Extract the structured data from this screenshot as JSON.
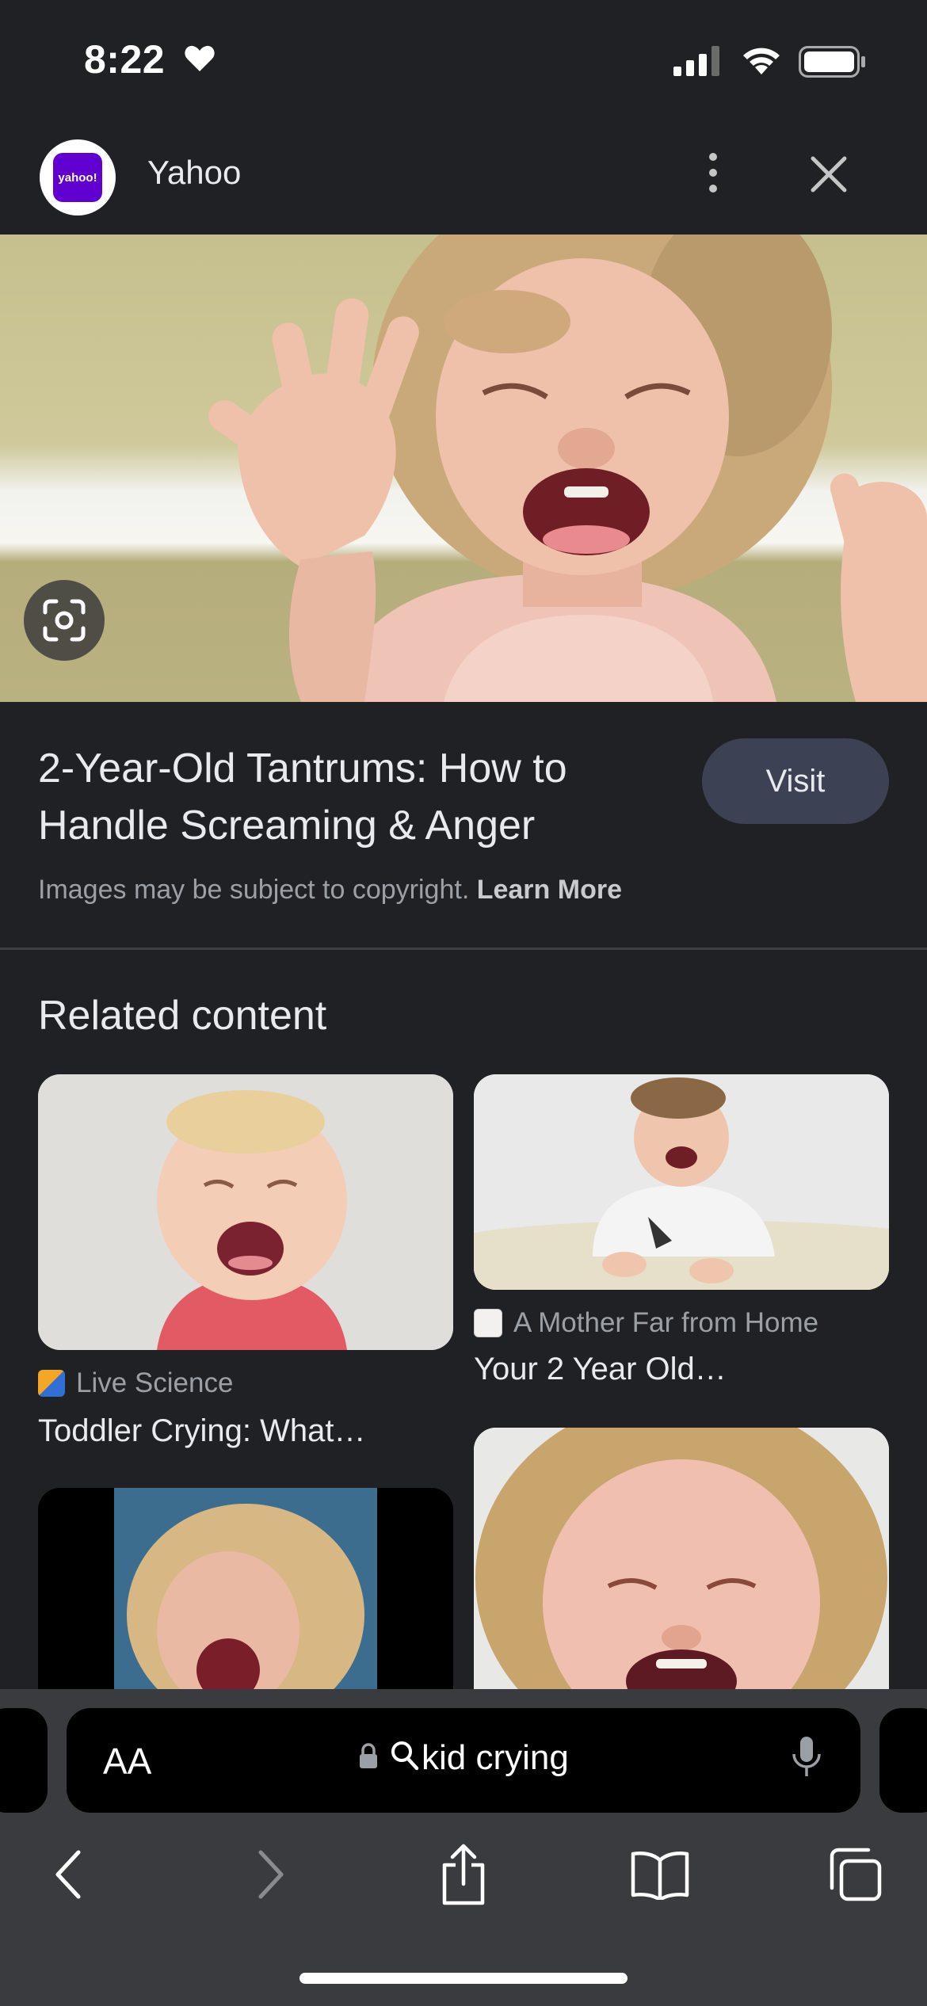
{
  "status_bar": {
    "time": "8:22"
  },
  "header": {
    "source_name": "Yahoo",
    "logo_text": "yahoo!"
  },
  "result": {
    "title": "2-Year-Old Tantrums: How to Handle Screaming & Anger",
    "visit_label": "Visit",
    "copyright_text": "Images may be subject to copyright.",
    "learn_more_label": "Learn More"
  },
  "related": {
    "heading": "Related content",
    "cards": [
      {
        "source": "Live Science",
        "title": "Toddler Crying: What…"
      },
      {
        "source": "A Mother Far from Home",
        "title": "Your 2 Year Old…"
      }
    ]
  },
  "address_bar": {
    "aa_label": "AA",
    "query": "kid crying"
  },
  "colors": {
    "background": "#202124",
    "visit_button": "#3c4254",
    "toolbar": "#3a3b3e"
  }
}
